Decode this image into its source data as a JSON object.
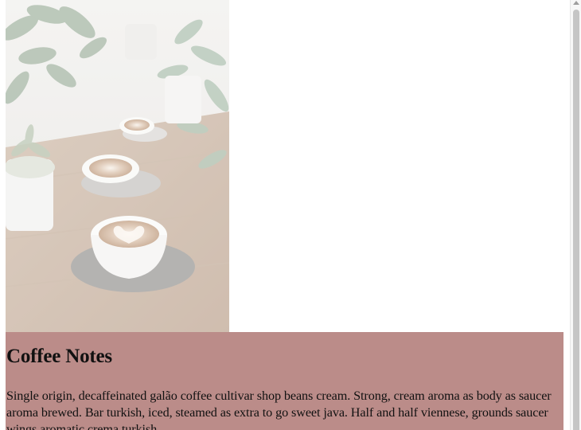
{
  "hero": {
    "alt": "Coffee cups with latte art on a wooden table with plants"
  },
  "article": {
    "title": "Coffee Notes",
    "body": "Single origin, decaffeinated galão coffee cultivar shop beans cream. Strong, cream aroma as body as saucer aroma brewed. Bar turkish, iced, steamed as extra to go sweet java. Half and half viennese, grounds saucer wings aromatic crema turkish."
  },
  "colors": {
    "panel_bg": "#bb8c89",
    "page_bg": "#ffffff"
  }
}
